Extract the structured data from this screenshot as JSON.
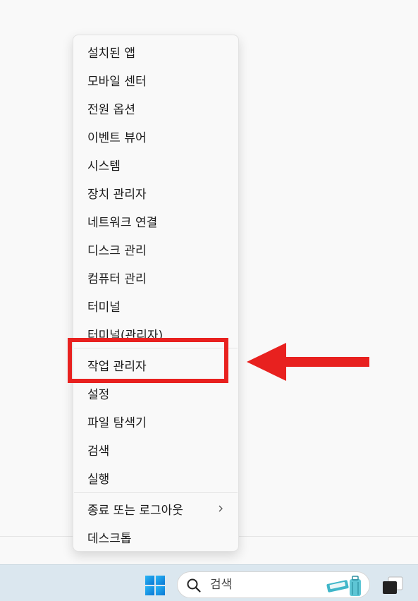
{
  "menu": {
    "items": [
      {
        "label": "설치된 앱"
      },
      {
        "label": "모바일 센터"
      },
      {
        "label": "전원 옵션"
      },
      {
        "label": "이벤트 뷰어"
      },
      {
        "label": "시스템"
      },
      {
        "label": "장치 관리자"
      },
      {
        "label": "네트워크 연결"
      },
      {
        "label": "디스크 관리"
      },
      {
        "label": "컴퓨터 관리"
      },
      {
        "label": "터미널"
      },
      {
        "label": "터미널(관리자)"
      },
      {
        "label": "작업 관리자"
      },
      {
        "label": "설정"
      },
      {
        "label": "파일 탐색기"
      },
      {
        "label": "검색"
      },
      {
        "label": "실행"
      },
      {
        "label": "종료 또는 로그아웃"
      },
      {
        "label": "데스크톱"
      }
    ]
  },
  "annotation": {
    "highlight_color": "#e8211f",
    "arrow_color": "#e8211f"
  },
  "taskbar": {
    "search_label": "검색",
    "start_icon": "windows-logo-icon",
    "search_icon": "search-icon",
    "taskview_icon": "task-view-icon"
  }
}
